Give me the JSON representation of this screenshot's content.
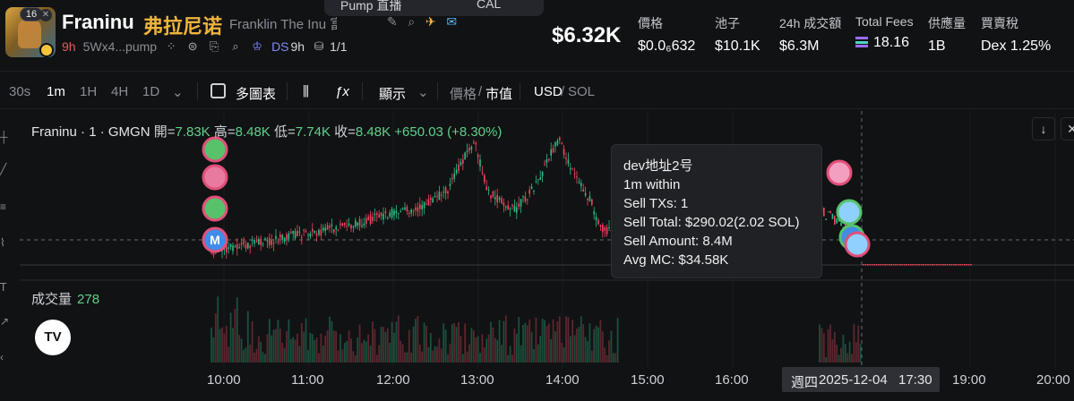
{
  "token": {
    "badge_count": "16",
    "name": "Franinu",
    "name_cn": "弗拉尼诺",
    "full_name": "Franklin The Inu 富兰...",
    "age": "9h",
    "address": "5Wx4...pump",
    "dev_source": "DS",
    "dev_age": "9h",
    "holders": "1/1"
  },
  "top_pill": {
    "label": "Pump 直播",
    "label2": "CAL"
  },
  "market_cap": "$6.32K",
  "stats": [
    {
      "label": "價格",
      "value": "$0.0₆632"
    },
    {
      "label": "池子",
      "value": "$10.1K"
    },
    {
      "label": "24h 成交額",
      "value": "$6.3M"
    },
    {
      "label": "Total Fees",
      "value": "18.16"
    },
    {
      "label": "供應量",
      "value": "1B"
    },
    {
      "label": "買賣稅",
      "value": "Dex 1.25%"
    }
  ],
  "toolbar": {
    "intervals": [
      "30s",
      "1m",
      "1H",
      "4H",
      "1D"
    ],
    "active_interval": "1m",
    "multi_chart": "多圖表",
    "display": "顯示",
    "price_label": "價格",
    "mcap_label": "市值",
    "currency": "USD",
    "currency2": "SOL"
  },
  "legend": {
    "symbol": "Franinu · 1 · GMGN",
    "open_label": "開=",
    "open": "7.83K",
    "high_label": "高=",
    "high": "8.48K",
    "low_label": "低=",
    "low": "7.74K",
    "close_label": "收=",
    "close": "8.48K",
    "change": "+650.03 (+8.30%)"
  },
  "volume": {
    "label": "成交量",
    "value": "278"
  },
  "tooltip": {
    "line1": "dev地址2号",
    "line2": "1m within",
    "line3": "Sell TXs: 1",
    "line4": "Sell Total: $290.02(2.02 SOL)",
    "line5": "Sell Amount: 8.4M",
    "line6": "Avg MC: $34.58K"
  },
  "xaxis": {
    "ticks": [
      "10:00",
      "11:00",
      "12:00",
      "13:00",
      "14:00",
      "15:00",
      "16:00",
      "19:00",
      "20:00"
    ],
    "cursor_day": "週四",
    "cursor_date": "2025-12-04",
    "cursor_time": "17:30"
  },
  "colors": {
    "up": "#2ebd85",
    "down": "#f6465d",
    "accent": "#f0b43c",
    "background": "#111214"
  }
}
